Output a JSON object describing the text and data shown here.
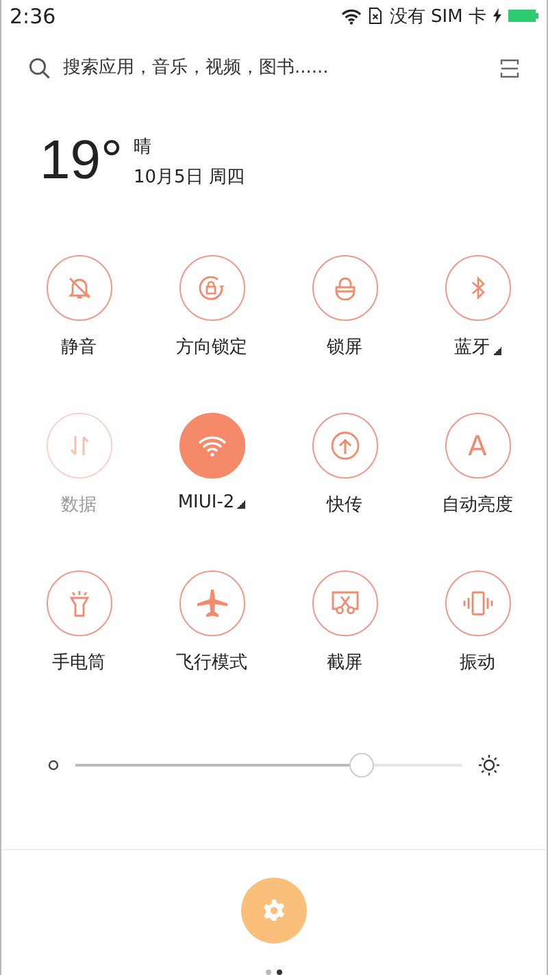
{
  "status_bar": {
    "time": "2:36",
    "carrier": "没有 SIM 卡",
    "charging": true
  },
  "search": {
    "placeholder": "搜索应用，音乐，视频，图书......"
  },
  "weather": {
    "temperature": "19°",
    "condition": "晴",
    "date": "10月5日 周四"
  },
  "toggles": [
    {
      "kind": "silent",
      "label": "静音",
      "on": false,
      "disabled": false,
      "has_menu": false
    },
    {
      "kind": "rotation-lock",
      "label": "方向锁定",
      "on": false,
      "disabled": false,
      "has_menu": false
    },
    {
      "kind": "lock",
      "label": "锁屏",
      "on": false,
      "disabled": false,
      "has_menu": false
    },
    {
      "kind": "bluetooth",
      "label": "蓝牙",
      "on": false,
      "disabled": false,
      "has_menu": true
    },
    {
      "kind": "data",
      "label": "数据",
      "on": false,
      "disabled": true,
      "has_menu": false
    },
    {
      "kind": "wifi",
      "label": "MIUI-2",
      "on": true,
      "disabled": false,
      "has_menu": true
    },
    {
      "kind": "transfer",
      "label": "快传",
      "on": false,
      "disabled": false,
      "has_menu": false
    },
    {
      "kind": "auto-brightness",
      "label": "自动亮度",
      "on": false,
      "disabled": false,
      "has_menu": false,
      "glyph": "A"
    },
    {
      "kind": "flashlight",
      "label": "手电筒",
      "on": false,
      "disabled": false,
      "has_menu": false
    },
    {
      "kind": "airplane",
      "label": "飞行模式",
      "on": false,
      "disabled": false,
      "has_menu": false
    },
    {
      "kind": "screenshot",
      "label": "截屏",
      "on": false,
      "disabled": false,
      "has_menu": false
    },
    {
      "kind": "vibrate",
      "label": "振动",
      "on": false,
      "disabled": false,
      "has_menu": false
    }
  ],
  "brightness": {
    "level": 0.74
  },
  "pages": [
    {
      "selected": false
    },
    {
      "selected": true
    }
  ]
}
